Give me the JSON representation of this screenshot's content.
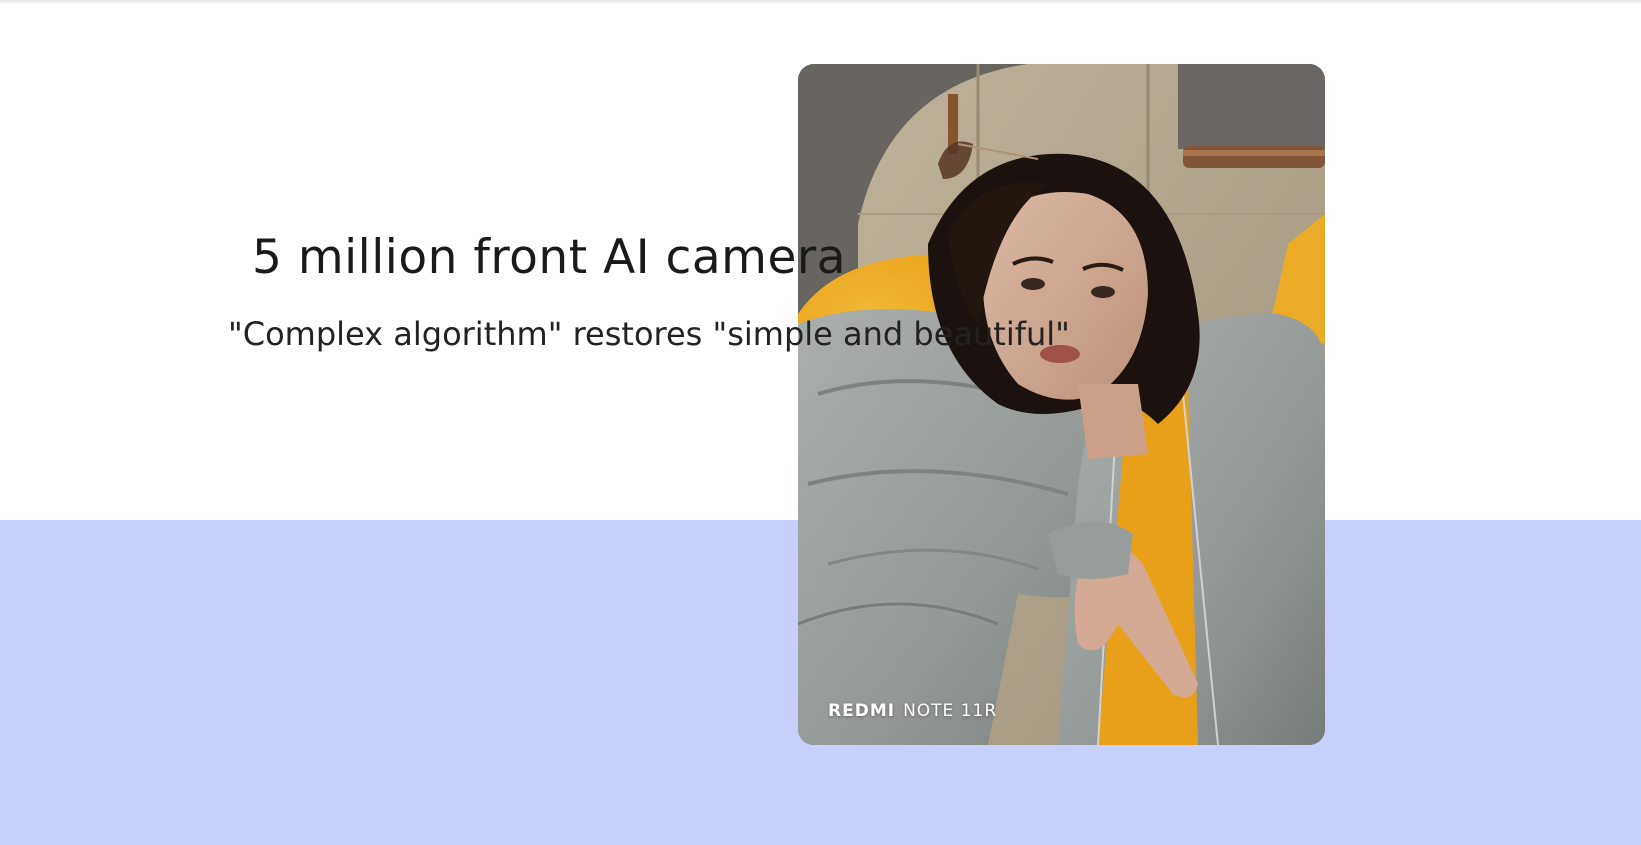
{
  "feature": {
    "title": "5 million front AI camera",
    "subtitle": "\"Complex algorithm\" restores \"simple and beautiful\""
  },
  "photo": {
    "watermark_brand": "REDMI",
    "watermark_model": "NOTE 11R"
  },
  "colors": {
    "page_background": "#ffffff",
    "band_background": "#c7cffc",
    "title_text": "#1a1a1a",
    "watermark_text": "#ffffff"
  }
}
